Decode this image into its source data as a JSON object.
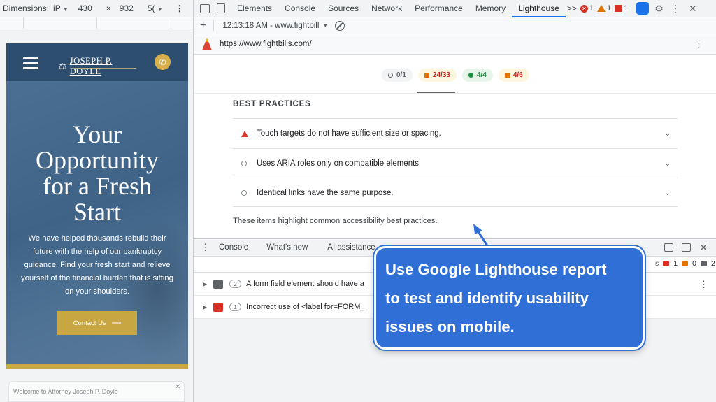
{
  "device_toolbar": {
    "dimensions_label": "Dimensions:",
    "device_value": "iP",
    "width": "430",
    "times": "×",
    "height": "932",
    "zoom": "5("
  },
  "devtools_tabs": [
    {
      "label": "Elements"
    },
    {
      "label": "Console"
    },
    {
      "label": "Sources"
    },
    {
      "label": "Network"
    },
    {
      "label": "Performance"
    },
    {
      "label": "Memory"
    },
    {
      "label": "Lighthouse",
      "active": true
    }
  ],
  "devtools_more": ">>",
  "status_badges": {
    "errors": "1",
    "warnings": "1",
    "issues": "1"
  },
  "lighthouse_toolbar": {
    "plus": "+",
    "report_label": "12:13:18 AM - www.fightbill",
    "caret": "▼"
  },
  "url_bar": {
    "url": "https://www.fightbills.com/",
    "kebab": "⋮"
  },
  "scores": [
    {
      "label": "0/1",
      "color": "#80868b"
    },
    {
      "label": "24/33",
      "color": "#c5221f"
    },
    {
      "label": "4/4",
      "color": "#188038"
    },
    {
      "label": "4/6",
      "color": "#c5221f"
    }
  ],
  "section": {
    "title": "BEST PRACTICES",
    "audits": [
      {
        "text": "Touch targets do not have sufficient size or spacing.",
        "status": "fail"
      },
      {
        "text": "Uses ARIA roles only on compatible elements",
        "status": "neutral"
      },
      {
        "text": "Identical links have the same purpose.",
        "status": "neutral"
      }
    ],
    "description": "These items highlight common accessibility best practices."
  },
  "drawer": {
    "tabs": [
      "Console",
      "What's new",
      "AI assistance"
    ],
    "issue_counts": {
      "errors": "1",
      "warnings": "0",
      "info": "2"
    },
    "issues": [
      {
        "count": "2",
        "text": "A form field element should have a",
        "type": "info"
      },
      {
        "count": "1",
        "text": "Incorrect use of <label for=FORM_",
        "type": "error"
      }
    ]
  },
  "phone": {
    "logo_text": "JOSEPH P. DOYLE",
    "hero_title": [
      "Your",
      "Opportunity",
      "for a Fresh",
      "Start"
    ],
    "hero_text": "We have helped thousands rebuild their future with the help of our bankruptcy guidance. Find your fresh start and relieve yourself of the financial burden that is sitting on your shoulders.",
    "cta": "Contact Us",
    "welcome": "Welcome to Attorney Joseph P. Doyle"
  },
  "callout": {
    "lines": [
      "Use Google Lighthouse report",
      "to test and identify usability",
      "issues on mobile."
    ]
  },
  "colors": {
    "accent": "#1a73e8",
    "callout": "#2f6fd6",
    "brand_navy": "#2d4e6f",
    "brand_gold": "#c8a642"
  }
}
